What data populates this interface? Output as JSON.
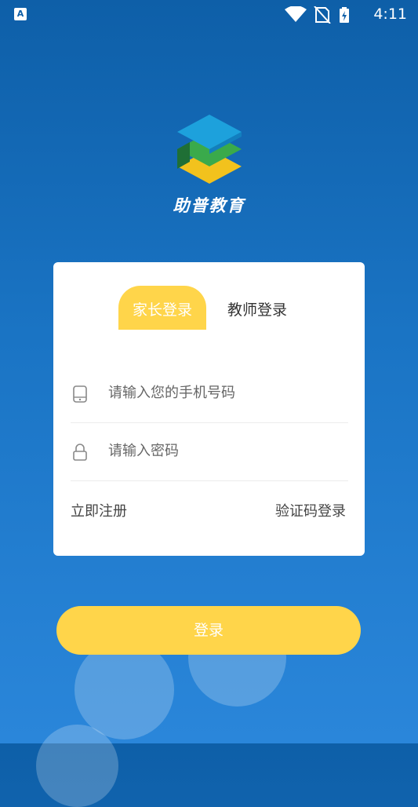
{
  "status_bar": {
    "time": "4:11",
    "app_icon": "A"
  },
  "logo": {
    "title": "助普教育",
    "icon": "layers-logo-icon"
  },
  "tabs": [
    {
      "label": "家长登录",
      "active": true
    },
    {
      "label": "教师登录",
      "active": false
    }
  ],
  "form": {
    "phone_placeholder": "请输入您的手机号码",
    "password_placeholder": "请输入密码"
  },
  "links": {
    "register": "立即注册",
    "code_login": "验证码登录"
  },
  "login_button": "登录",
  "colors": {
    "accent": "#ffd54a",
    "bg_top": "#0e5fa8",
    "bg_bottom": "#2a86da"
  }
}
